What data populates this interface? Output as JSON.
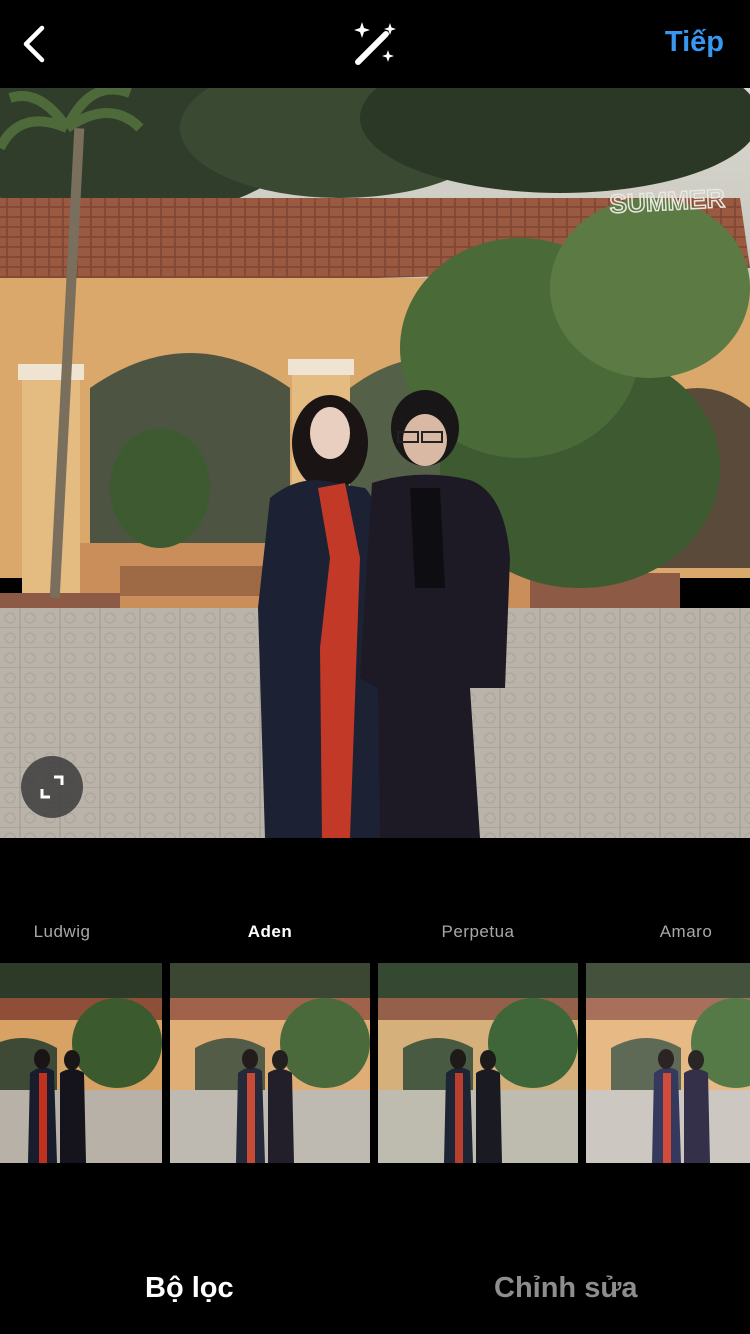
{
  "header": {
    "next_label": "Tiếp"
  },
  "photo": {
    "watermark": "SUMMER"
  },
  "filters": [
    {
      "label": "Ludwig",
      "selected": false
    },
    {
      "label": "Aden",
      "selected": true
    },
    {
      "label": "Perpetua",
      "selected": false
    },
    {
      "label": "Amaro",
      "selected": false
    }
  ],
  "tabs": {
    "filter_label": "Bộ lọc",
    "edit_label": "Chỉnh sửa",
    "active": "filter"
  },
  "colors": {
    "accent": "#3897f0",
    "inactive_text": "#8e8e8e",
    "background": "#000000"
  },
  "icons": {
    "back": "chevron-left-icon",
    "magic": "magic-wand-icon",
    "expand": "expand-icon"
  }
}
